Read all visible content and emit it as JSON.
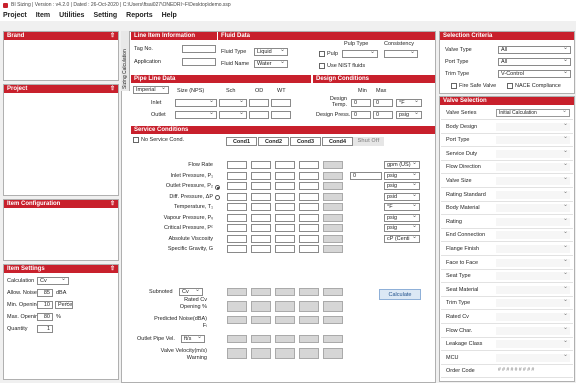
{
  "window": {
    "title": "BI Sizing | Version : v4.2.0 | Dated : 26-Oct-2020 | C:\\Users\\ftsai027\\ONEDRI~F\\Desktop\\demo.ssp"
  },
  "menu": [
    "Project",
    "Item",
    "Utilities",
    "Setting",
    "Reports",
    "Help"
  ],
  "left": {
    "brand": "Brand",
    "project": "Project",
    "item_config": "Item Configuration",
    "item_settings": "Item Settings",
    "settings": {
      "calculation_label": "Calculation",
      "calculation_value": "Cv",
      "noise_label": "Allow. Noise",
      "noise_value": "85",
      "noise_unit": "dBA",
      "min_open_label": "Min. Opening",
      "min_open_value": "10",
      "min_open_unit": "Perce",
      "max_open_label": "Max. Opening",
      "max_open_value": "80",
      "max_open_unit": "%",
      "qty_label": "Quantity",
      "qty_value": "1"
    }
  },
  "vtab": "Sizing Calculation",
  "line_item": {
    "title": "Line Item Information",
    "tag_label": "Tag No.",
    "app_label": "Application"
  },
  "fluid": {
    "title": "Fluid Data",
    "type_label": "Fluid Type",
    "type_value": "Liquid",
    "name_label": "Fluid Name",
    "name_value": "Water",
    "pulp_type": "Pulp Type",
    "consistency": "Consistency",
    "pulp_label": "Pulp",
    "nist_label": "Use NIST fluids"
  },
  "pipe": {
    "title": "Pipe Line Data",
    "unit": "Imperial",
    "size_h": "Size (NPS)",
    "sch_h": "Sch",
    "od_h": "OD",
    "wt_h": "WT",
    "inlet": "Inlet",
    "outlet": "Outlet"
  },
  "design": {
    "title": "Design Conditions",
    "min_h": "Min",
    "max_h": "Max",
    "temp_label": "Design Temp.",
    "temp_min": "0",
    "temp_max": "0",
    "temp_unit": "°F",
    "press_label": "Design Press.",
    "press_min": "0",
    "press_max": "0",
    "press_unit": "psig"
  },
  "service": {
    "title": "Service Conditions",
    "no_service": "No Service Cond.",
    "tabs": [
      "Cond1",
      "Cond2",
      "Cond3",
      "Cond4",
      "Shut Off"
    ],
    "rows": [
      {
        "label": "Flow Rate",
        "unit": "gpm (US)"
      },
      {
        "label": "Inlet Pressure, P₁",
        "unit": "psig",
        "extra": "0"
      },
      {
        "label": "Outlet Pressure, P₂",
        "unit": "psig"
      },
      {
        "label": "Diff. Pressure, ΔP",
        "unit": "psid"
      },
      {
        "label": "Temperature, T₁",
        "unit": "°F"
      },
      {
        "label": "Vapour Pressure, Pᵥ",
        "unit": "psig"
      },
      {
        "label": "Critical Pressure, Pᶜ",
        "unit": "psig"
      },
      {
        "label": "Absolute Viscosity",
        "unit": "cP (Centi"
      },
      {
        "label": "Specific Gravity, G",
        "unit": ""
      }
    ],
    "result_labels": [
      "Rated Cv",
      "Opening %",
      "Predicted Noise(dBA)",
      "Fₗ",
      "Valve Velocity(m/s)",
      "Warning"
    ],
    "subnoted_label": "Subnoted",
    "subnoted_value": "Cv",
    "outlet_vel_label": "Outlet Pipe Vel.",
    "outlet_vel_value": "ft/s",
    "calculate": "Calculate"
  },
  "selection": {
    "title": "Selection Criteria",
    "valve_type_label": "Valve Type",
    "valve_type_value": "All",
    "port_type_label": "Port Type",
    "port_type_value": "All",
    "trim_type_label": "Trim Type",
    "trim_type_value": "V-Control",
    "fire_safe": "Fire Safe Valve",
    "nace": "NACE Compliance"
  },
  "valve_sel": {
    "title": "Valve Selection",
    "props": [
      {
        "label": "Valve Series",
        "value": "Initial Calculation"
      },
      {
        "label": "Body Design",
        "value": ""
      },
      {
        "label": "Port Type",
        "value": ""
      },
      {
        "label": "Service Duty",
        "value": ""
      },
      {
        "label": "Flow Direction",
        "value": ""
      },
      {
        "label": "Valve Size",
        "value": ""
      },
      {
        "label": "Rating Standard",
        "value": ""
      },
      {
        "label": "Body Material",
        "value": ""
      },
      {
        "label": "Rating",
        "value": ""
      },
      {
        "label": "End Connection",
        "value": ""
      },
      {
        "label": "Flange Finish",
        "value": ""
      },
      {
        "label": "Face to Face",
        "value": ""
      },
      {
        "label": "Seat Type",
        "value": ""
      },
      {
        "label": "Seat Material",
        "value": ""
      },
      {
        "label": "Trim Type",
        "value": ""
      },
      {
        "label": "Rated Cv",
        "value": ""
      },
      {
        "label": "Flow Char.",
        "value": ""
      },
      {
        "label": "Leakage Class",
        "value": ""
      },
      {
        "label": "MCU",
        "value": ""
      },
      {
        "label": "Order Code",
        "value": "# # # # # # # # #"
      }
    ]
  },
  "colors": {
    "accent": "#c8202c"
  }
}
